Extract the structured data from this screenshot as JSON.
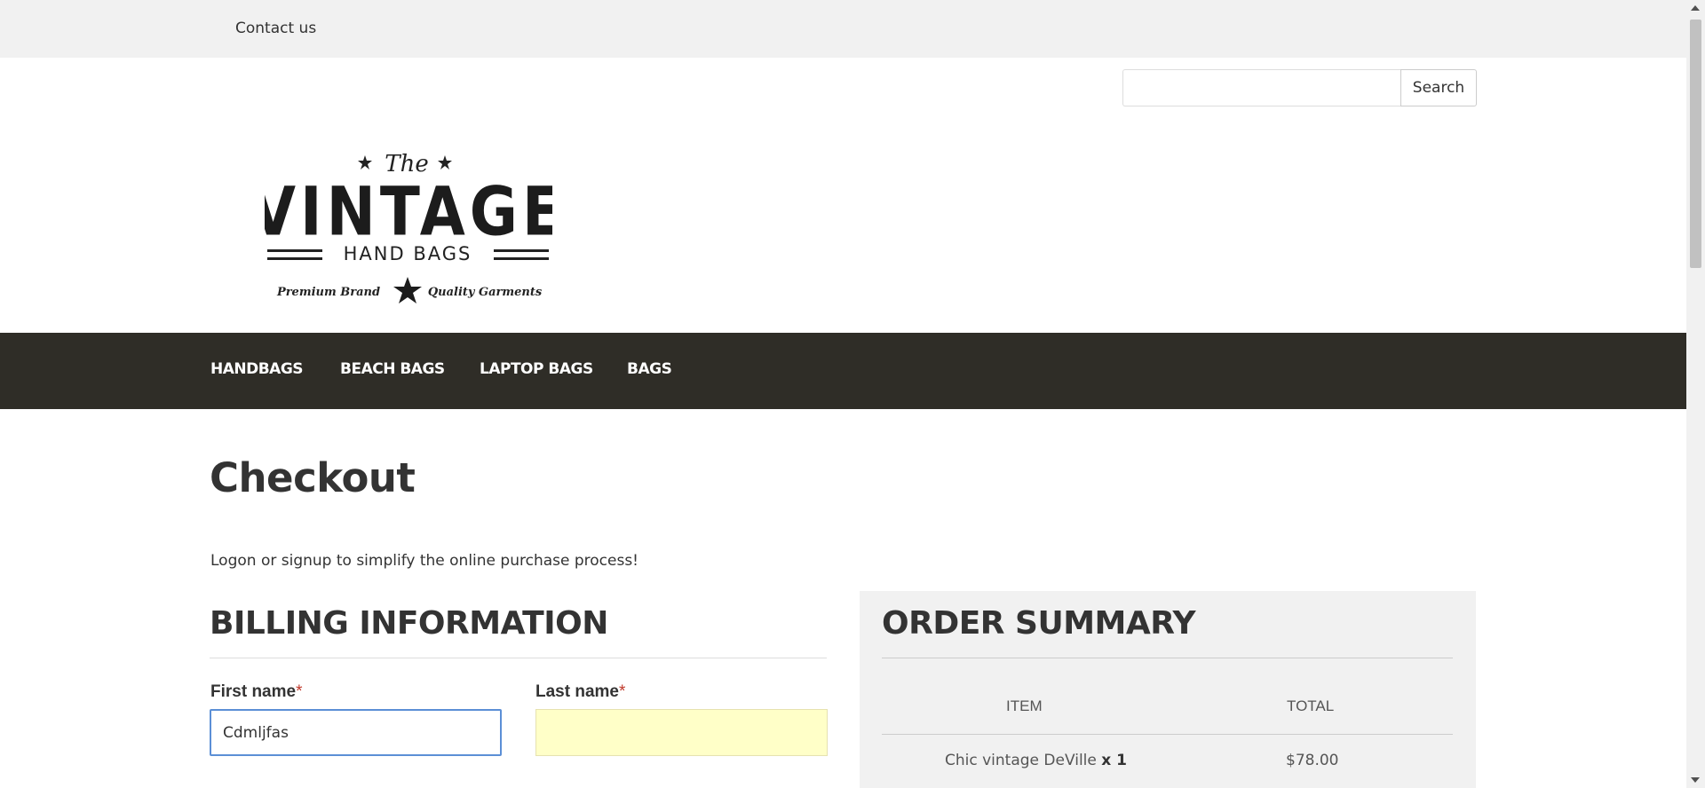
{
  "topbar": {
    "contact_label": "Contact us"
  },
  "logo": {
    "text_the": "The",
    "text_main": "VINTAGE",
    "text_sub": "HAND BAGS",
    "text_left": "Premium Brand",
    "text_right": "Quality Garments"
  },
  "search": {
    "value": "",
    "button_label": "Search"
  },
  "nav": {
    "items": [
      "HANDBAGS",
      "BEACH BAGS",
      "LAPTOP BAGS",
      "BAGS"
    ]
  },
  "page": {
    "title": "Checkout",
    "logon_message": "Logon or signup to simplify the online purchase process!"
  },
  "billing": {
    "title": "BILLING INFORMATION",
    "first_name_label": "First name",
    "last_name_label": "Last name",
    "required_mark": "*",
    "first_name_value": "Cdmljfas",
    "last_name_value": ""
  },
  "summary": {
    "title": "ORDER SUMMARY",
    "col_item": "ITEM",
    "col_total": "TOTAL",
    "rows": [
      {
        "item": "Chic vintage DeVille",
        "qty": "x 1",
        "total": "$78.00"
      }
    ]
  },
  "colors": {
    "navbar_bg": "#2f2d27",
    "topbar_bg": "#f1f1f1",
    "required": "#c0392b",
    "field_focus": "#5b8fd6",
    "autofill_bg": "#ffffc8"
  }
}
